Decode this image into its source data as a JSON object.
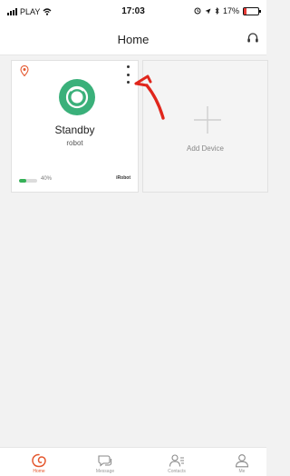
{
  "status_bar": {
    "carrier": "PLAY",
    "time": "17:03",
    "battery": "17%",
    "battery_level": 0.17
  },
  "header": {
    "title": "Home",
    "headset_icon": "headset-icon"
  },
  "devices": [
    {
      "status": "Standby",
      "name": "robot",
      "battery": "40%",
      "battery_level": 0.4,
      "brand": "iRobot",
      "icon": "robot-vacuum-icon",
      "menu_icon": "more-vertical-icon",
      "pin_icon": "location-pin-icon"
    }
  ],
  "add_device": {
    "label": "Add Device",
    "icon": "plus-icon"
  },
  "annotation": {
    "icon": "red-arrow-icon",
    "color": "#e0261c"
  },
  "bottom_nav": [
    {
      "label": "Home",
      "icon": "home-icon",
      "active": true
    },
    {
      "label": "Message",
      "icon": "message-icon",
      "active": false
    },
    {
      "label": "Contacts",
      "icon": "contacts-icon",
      "active": false
    },
    {
      "label": "Me",
      "icon": "me-icon",
      "active": false
    }
  ],
  "colors": {
    "accent": "#e4572e",
    "robot_green": "#3ab07a",
    "battery_green": "#35b157"
  }
}
